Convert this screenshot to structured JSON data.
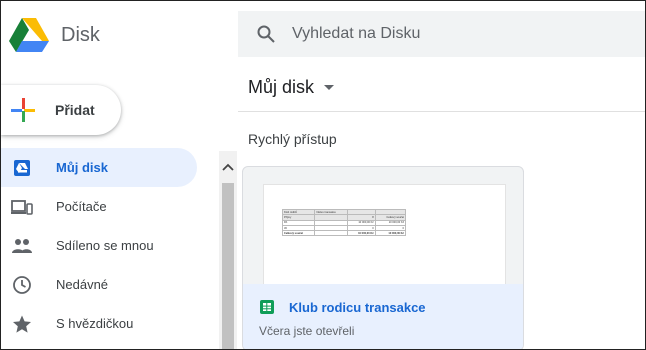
{
  "app": {
    "title": "Disk",
    "logo_icon": "google-drive-logo-icon"
  },
  "sidebar": {
    "new_button": {
      "label": "Přidat",
      "icon": "plus-icon"
    },
    "items": [
      {
        "label": "Můj disk",
        "icon": "drive-icon",
        "active": true
      },
      {
        "label": "Počítače",
        "icon": "computer-icon",
        "active": false
      },
      {
        "label": "Sdíleno se mnou",
        "icon": "people-icon",
        "active": false
      },
      {
        "label": "Nedávné",
        "icon": "clock-icon",
        "active": false
      },
      {
        "label": "S hvězdičkou",
        "icon": "star-icon",
        "active": false
      }
    ]
  },
  "search": {
    "placeholder": "Vyhledat na Disku",
    "value": ""
  },
  "main": {
    "title": "Můj disk",
    "quick_access_title": "Rychlý přístup",
    "cards": [
      {
        "name": "Klub rodicu transakce",
        "subtitle": "Včera jste otevřeli",
        "icon": "google-sheets-icon",
        "preview": {
          "rows": [
            [
              "Klub rodičů",
              "Název transakce",
              "",
              ""
            ],
            [
              "Příjmy",
              "",
              "8",
              "Celkový součet"
            ],
            [
              "PA",
              "",
              "10 000,00 Kč",
              "10 000,00 Kč"
            ],
            [
              "30",
              "",
              "0",
              "0"
            ],
            [
              "Celkový součet",
              "",
              "10 000,00 Kč",
              "10 000,00 Kč"
            ]
          ]
        }
      }
    ]
  },
  "colors": {
    "accent": "#1967d2",
    "active_bg": "#e8f0fe",
    "search_bg": "#f1f3f4"
  }
}
